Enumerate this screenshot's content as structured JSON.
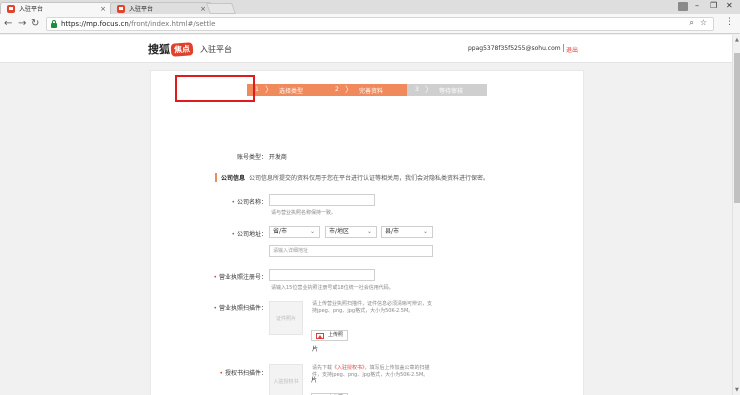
{
  "browser": {
    "tabs": [
      {
        "title": "入驻平台",
        "active": true
      },
      {
        "title": "入驻平台",
        "active": false
      }
    ],
    "url_host": "https://mp.focus.cn",
    "url_path": "/front/index.html#/settle"
  },
  "header": {
    "logo_brand": "搜狐",
    "logo_badge": "焦点",
    "platform": "入驻平台",
    "email": "ppag5378f35f5255@sohu.com",
    "logout": "退出"
  },
  "steps": [
    {
      "num": "1",
      "label": "选择类型"
    },
    {
      "num": "2",
      "label": "完善资料"
    },
    {
      "num": "3",
      "label": "等待审核"
    }
  ],
  "account_type": "账号类型：  开发商",
  "section": {
    "title": "公司信息",
    "desc": "公司信息所提交的资料仅用于您在平台进行认证等相关用，我们会对隐私类资料进行保密。"
  },
  "form": {
    "company_name_label": "公司名称：",
    "company_name_hint": "请与营业执照名称保持一致。",
    "address_label": "公司地址：",
    "province": "省/市",
    "city": "市/地区",
    "county": "县/市",
    "address_placeholder": "请输入详细地址",
    "license_no_label": "营业执照注册号：",
    "license_no_hint": "请输入15位营业执照注册号或18位统一社会信用代码。",
    "license_scan_label": "营业执照扫描件：",
    "license_scan_box": "证件照片",
    "license_scan_hint": "请上传营业执照扫描件，证件信息必须清晰可辨识，支持jpeg、png、jpg格式，大小为50K-2.5M。",
    "upload_label": "上传照",
    "pian": "片",
    "auth_label": "授权书扫描件：",
    "auth_box": "入驻授权书",
    "auth_hint_pre": "请先下载",
    "auth_hint_link": "《入驻授权书》",
    "auth_hint_post": "，填写后上传加盖公章的扫描件，支持jpeg、png、jpg格式，大小为50K-2.5M。"
  }
}
